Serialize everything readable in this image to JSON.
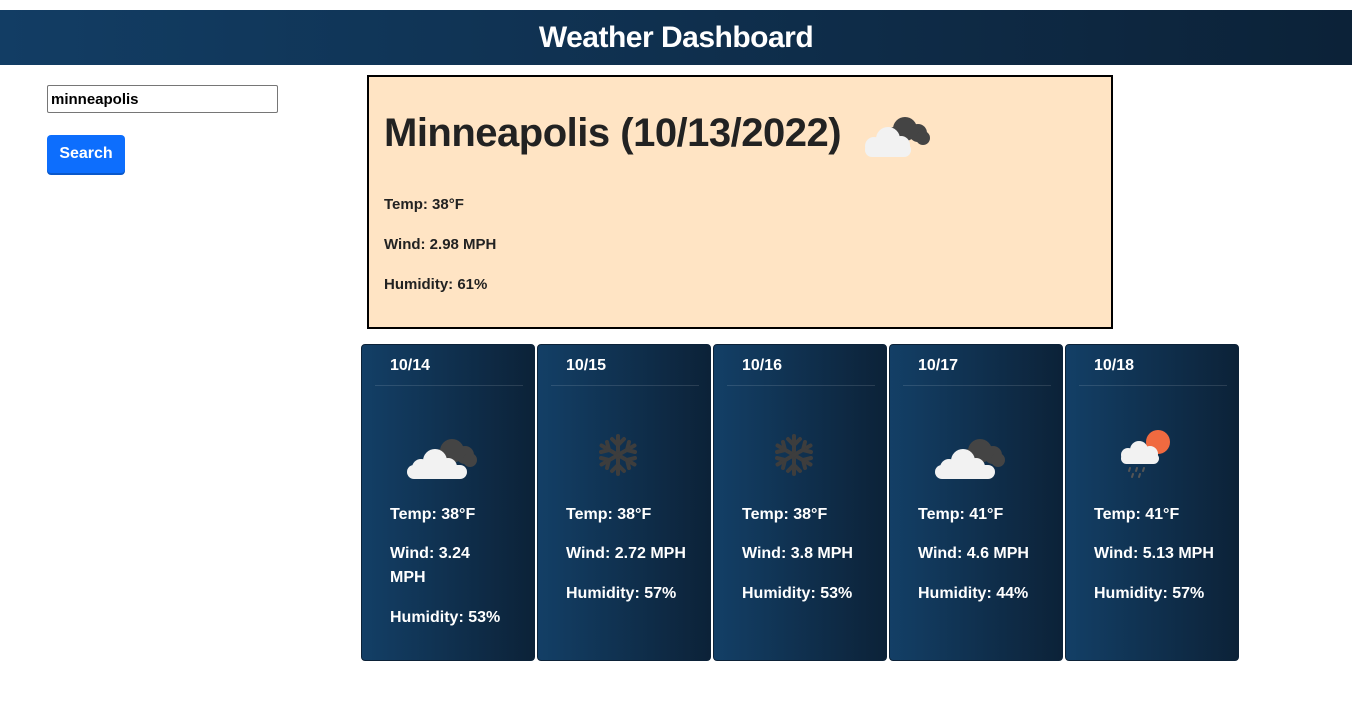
{
  "header": {
    "title": "Weather Dashboard"
  },
  "search": {
    "value": "minneapolis",
    "button_label": "Search"
  },
  "current": {
    "title": "Minneapolis (10/13/2022)",
    "icon": "broken-clouds-icon",
    "temp": "Temp: 38°F",
    "wind": "Wind: 2.98 MPH",
    "humidity": "Humidity: 61%"
  },
  "forecast": [
    {
      "date": "10/14",
      "icon": "broken-clouds-icon",
      "temp": "Temp: 38°F",
      "wind": "Wind: 3.24 MPH",
      "humidity": "Humidity: 53%"
    },
    {
      "date": "10/15",
      "icon": "snow-icon",
      "temp": "Temp: 38°F",
      "wind": "Wind: 2.72 MPH",
      "humidity": "Humidity: 57%"
    },
    {
      "date": "10/16",
      "icon": "snow-icon",
      "temp": "Temp: 38°F",
      "wind": "Wind: 3.8 MPH",
      "humidity": "Humidity: 53%"
    },
    {
      "date": "10/17",
      "icon": "broken-clouds-icon",
      "temp": "Temp: 41°F",
      "wind": "Wind: 4.6 MPH",
      "humidity": "Humidity: 44%"
    },
    {
      "date": "10/18",
      "icon": "rain-sun-icon",
      "temp": "Temp: 41°F",
      "wind": "Wind: 5.13 MPH",
      "humidity": "Humidity: 57%"
    }
  ]
}
